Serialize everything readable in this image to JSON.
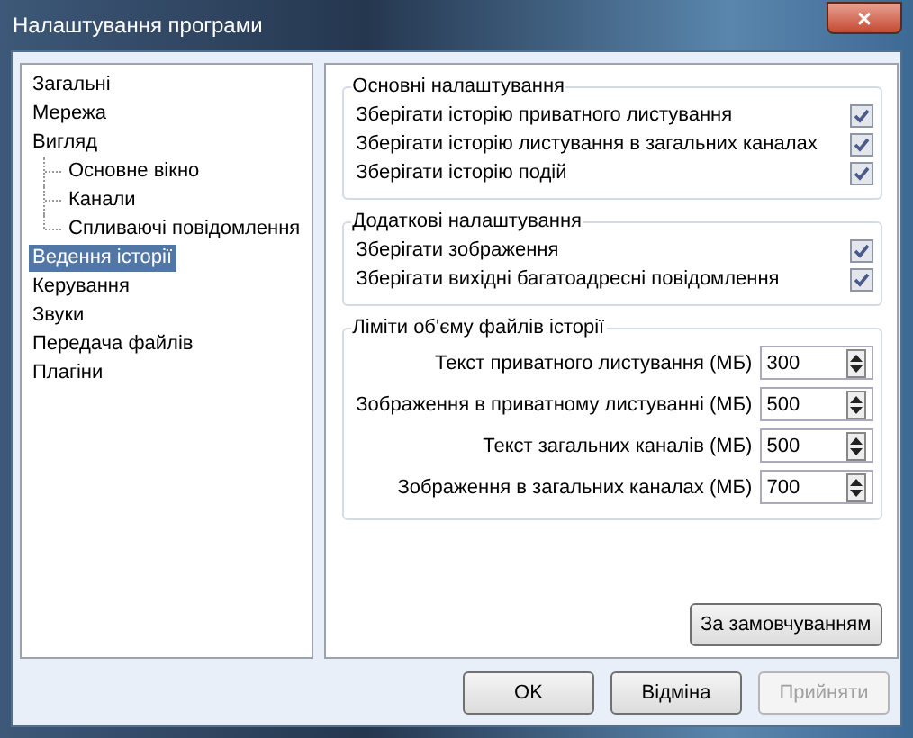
{
  "window": {
    "title": "Налаштування програми",
    "close": "×"
  },
  "sidebar": {
    "items": [
      {
        "label": "Загальні",
        "selected": false
      },
      {
        "label": "Мережа",
        "selected": false
      },
      {
        "label": "Вигляд",
        "selected": false,
        "children": [
          {
            "label": "Основне вікно",
            "selected": false
          },
          {
            "label": "Канали",
            "selected": false
          },
          {
            "label": "Спливаючі повідомлення",
            "selected": false
          }
        ]
      },
      {
        "label": "Ведення історії",
        "selected": true
      },
      {
        "label": "Керування",
        "selected": false
      },
      {
        "label": "Звуки",
        "selected": false
      },
      {
        "label": "Передача файлів",
        "selected": false
      },
      {
        "label": "Плагіни",
        "selected": false
      }
    ]
  },
  "groups": [
    {
      "title": "Основні налаштування",
      "checkboxes": [
        {
          "label": "Зберігати історію приватного листування",
          "checked": true
        },
        {
          "label": "Зберігати історію листування в загальних каналах",
          "checked": true
        },
        {
          "label": "Зберігати історію подій",
          "checked": true
        }
      ]
    },
    {
      "title": "Додаткові налаштування",
      "checkboxes": [
        {
          "label": "Зберігати зображення",
          "checked": true
        },
        {
          "label": "Зберігати вихідні багатоадресні повідомлення",
          "checked": true
        }
      ]
    }
  ],
  "limits": {
    "title": "Ліміти об'єму файлів історії",
    "fields": [
      {
        "label": "Текст приватного листування (МБ)",
        "value": "300"
      },
      {
        "label": "Зображення в приватному листуванні (МБ)",
        "value": "500"
      },
      {
        "label": "Текст загальних каналів (МБ)",
        "value": "500"
      },
      {
        "label": "Зображення в загальних каналах (МБ)",
        "value": "700"
      }
    ]
  },
  "defaults_button": "За замовчуванням",
  "buttons": [
    {
      "label": "OK",
      "disabled": false
    },
    {
      "label": "Відміна",
      "disabled": false
    },
    {
      "label": "Прийняти",
      "disabled": true
    }
  ]
}
